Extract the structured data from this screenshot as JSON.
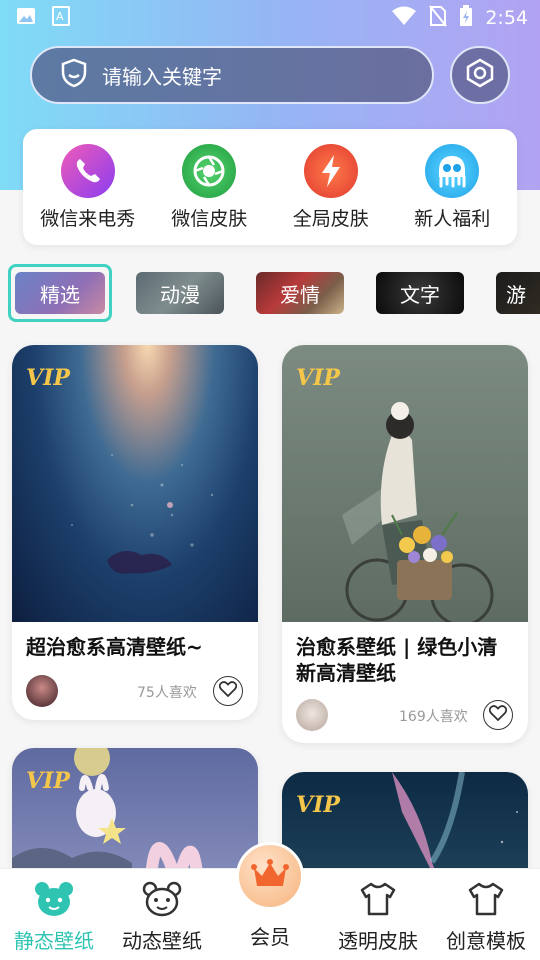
{
  "status_bar": {
    "time": "2:54",
    "icons": [
      "image-icon",
      "text-icon",
      "wifi-icon",
      "no-sim-icon",
      "battery-charging-icon"
    ]
  },
  "search": {
    "placeholder": "请输入关键字",
    "icon": "shield-icon"
  },
  "settings": {
    "icon": "hexagon-settings-icon"
  },
  "features": [
    {
      "label": "微信来电秀",
      "icon": "phone-icon",
      "color": "#c44be6"
    },
    {
      "label": "微信皮肤",
      "icon": "camera-aperture-icon",
      "color": "#2bbf5a"
    },
    {
      "label": "全局皮肤",
      "icon": "lightning-icon",
      "color": "#f2583a"
    },
    {
      "label": "新人福利",
      "icon": "octopus-icon",
      "color": "#2fb8f0"
    }
  ],
  "categories": [
    {
      "label": "精选",
      "selected": true
    },
    {
      "label": "动漫",
      "selected": false
    },
    {
      "label": "爱情",
      "selected": false
    },
    {
      "label": "文字",
      "selected": false
    },
    {
      "label": "游",
      "selected": false
    }
  ],
  "cards": [
    {
      "vip": "VIP",
      "title": "超治愈系高清壁纸~",
      "likes": "75人喜欢"
    },
    {
      "vip": "VIP",
      "title": "治愈系壁纸 | 绿色小清新高清壁纸",
      "likes": "169人喜欢"
    },
    {
      "vip": "VIP",
      "title": "",
      "likes": ""
    },
    {
      "vip": "VIP",
      "title": "",
      "likes": ""
    }
  ],
  "tabbar": {
    "tabs": [
      {
        "label": "静态壁纸",
        "icon": "bear-icon",
        "active": true
      },
      {
        "label": "动态壁纸",
        "icon": "bear-outline-icon",
        "active": false
      },
      {
        "label": "会员",
        "icon": "crown-icon",
        "active": false
      },
      {
        "label": "透明皮肤",
        "icon": "tshirt-icon",
        "active": false
      },
      {
        "label": "创意模板",
        "icon": "tshirt-icon",
        "active": false
      }
    ]
  },
  "colors": {
    "accent": "#2fc4b2",
    "vip_gold": "#f4c64a"
  }
}
